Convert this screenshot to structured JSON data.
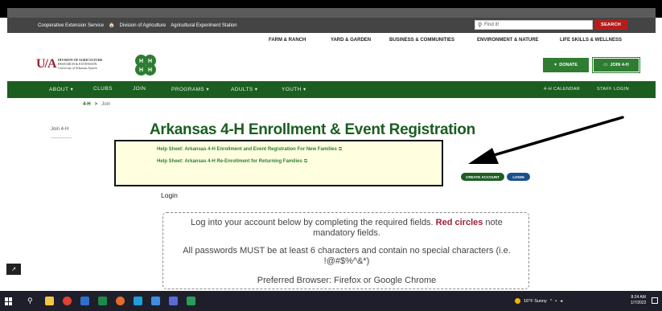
{
  "util_bar": {
    "cooperative": "Cooperative Extension Service",
    "home_icon": "🏠",
    "division_agriculture": "Division of Agriculture",
    "ag_experiment": "Agricultural Experiment Station",
    "search_placeholder": "Find it!",
    "search_button": "SEARCH"
  },
  "category_nav": [
    {
      "label": "FARM & RANCH"
    },
    {
      "label": "YARD & GARDEN"
    },
    {
      "label": "BUSINESS & COMMUNITIES"
    },
    {
      "label": "ENVIRONMENT & NATURE"
    },
    {
      "label": "LIFE SKILLS & WELLNESS"
    }
  ],
  "logo": {
    "mark": "U/A",
    "line1": "DIVISION OF AGRICULTURE",
    "line2": "RESEARCH & EXTENSION",
    "line3": "University of Arkansas System",
    "clover_letters": [
      "H",
      "H",
      "H",
      "H"
    ]
  },
  "header_buttons": {
    "donate": "DONATE",
    "join": "JOIN 4-H"
  },
  "main_nav": {
    "items": [
      {
        "label": "ABOUT ▾"
      },
      {
        "label": "CLUBS"
      },
      {
        "label": "JOIN"
      },
      {
        "label": "PROGRAMS ▾"
      },
      {
        "label": "ADULTS ▾"
      },
      {
        "label": "YOUTH ▾"
      }
    ],
    "calendar": "4-H CALENDAR",
    "staff_login": "STAFF LOGIN"
  },
  "breadcrumb": {
    "home": "4-H",
    "separator": ">",
    "current": "Join"
  },
  "sidebar": {
    "link": "Join 4-H"
  },
  "page": {
    "title": "Arkansas 4-H Enrollment & Event Registration",
    "help_links": [
      {
        "label": "Help Sheet: Arkansas 4-H Enrollment and Event Registration For New Families"
      },
      {
        "label": "Help Sheet: Arkansas 4-H Re-Enrollment for Returning Families"
      }
    ],
    "external_glyph": "⧉",
    "create_account": "CREATE ACCOUNT",
    "login": "LOGIN",
    "login_heading": "Login",
    "notice_pre": "Log into your account below by completing the required fields. ",
    "notice_red": "Red circles",
    "notice_post": " note mandatory fields.",
    "password_notice": "All passwords MUST be at least 6 characters and contain no special characters (i.e. !@#$%^&*)",
    "browser_notice": "Preferred Browser: Firefox or Google Chrome"
  },
  "taskbar": {
    "weather": "16°F Sunny",
    "time": "8:24 AM",
    "date": "1/7/2022"
  },
  "colors": {
    "green": "#1b5e20",
    "red": "#9d2235",
    "help_bg": "#ffffe0"
  }
}
